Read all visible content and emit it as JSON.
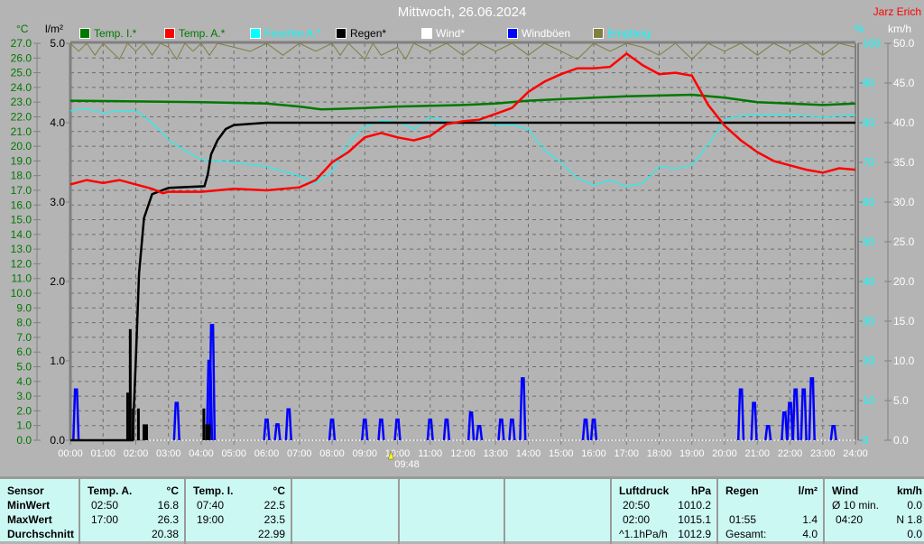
{
  "header": {
    "title": "Mittwoch, 26.06.2024",
    "author": "Jarz Erich"
  },
  "units": {
    "temp": "°C",
    "rain": "l/m²",
    "humidity": "%",
    "wind": "km/h"
  },
  "legend": [
    {
      "label": "Temp. I.*",
      "color": "#007800",
      "text_color": "#007800"
    },
    {
      "label": "Temp. A.*",
      "color": "#ff0000",
      "text_color": "#007800"
    },
    {
      "label": "Feuchte A.*",
      "color": "#00ffff",
      "text_color": "#00ffff"
    },
    {
      "label": "Regen*",
      "color": "#000000",
      "text_color": "#000000"
    },
    {
      "label": "Wind*",
      "color": "#ffffff",
      "text_color": "#ffffff"
    },
    {
      "label": "Windböen",
      "color": "#0000ff",
      "text_color": "#ffffff"
    },
    {
      "label": "Empfang",
      "color": "#7f7f40",
      "text_color": "#00ffff"
    }
  ],
  "marker": {
    "time": "09:48",
    "hour": 9.8
  },
  "chart_data": {
    "type": "line",
    "title": "Mittwoch, 26.06.2024",
    "xlabel": "",
    "xlim": [
      0,
      24
    ],
    "x_ticks": [
      "00:00",
      "01:00",
      "02:00",
      "03:00",
      "04:00",
      "05:00",
      "06:00",
      "07:00",
      "08:00",
      "09:00",
      "10:00",
      "11:00",
      "12:00",
      "13:00",
      "14:00",
      "15:00",
      "16:00",
      "17:00",
      "18:00",
      "19:00",
      "20:00",
      "21:00",
      "22:00",
      "23:00",
      "24:00"
    ],
    "axes": {
      "temp": {
        "label": "°C",
        "range": [
          0,
          27
        ],
        "ticks": [
          "0.0",
          "1.0",
          "2.0",
          "3.0",
          "4.0",
          "5.0",
          "6.0",
          "7.0",
          "8.0",
          "9.0",
          "10.0",
          "11.0",
          "12.0",
          "13.0",
          "14.0",
          "15.0",
          "16.0",
          "17.0",
          "18.0",
          "19.0",
          "20.0",
          "21.0",
          "22.0",
          "23.0",
          "24.0",
          "25.0",
          "26.0",
          "27.0"
        ]
      },
      "rain": {
        "label": "l/m²",
        "range": [
          0,
          5
        ],
        "ticks": [
          "0.0",
          "1.0",
          "2.0",
          "3.0",
          "4.0",
          "5.0"
        ]
      },
      "humidity": {
        "label": "%",
        "range": [
          0,
          100
        ],
        "ticks": [
          "0",
          "10",
          "20",
          "30",
          "40",
          "50",
          "60",
          "70",
          "80",
          "90",
          "100"
        ]
      },
      "wind": {
        "label": "km/h",
        "range": [
          0,
          50
        ],
        "ticks": [
          "0.0",
          "5.0",
          "10.0",
          "15.0",
          "20.0",
          "25.0",
          "30.0",
          "35.0",
          "40.0",
          "45.0",
          "50.0"
        ]
      }
    },
    "grid": true,
    "series": [
      {
        "name": "Temp. I.*",
        "axis": "temp",
        "color": "#007800",
        "points": [
          [
            0,
            23.1
          ],
          [
            4,
            23.0
          ],
          [
            6,
            22.9
          ],
          [
            7,
            22.7
          ],
          [
            7.67,
            22.5
          ],
          [
            9,
            22.6
          ],
          [
            10,
            22.7
          ],
          [
            12,
            22.8
          ],
          [
            13,
            22.9
          ],
          [
            14,
            23.1
          ],
          [
            15,
            23.2
          ],
          [
            16,
            23.3
          ],
          [
            17,
            23.4
          ],
          [
            19,
            23.5
          ],
          [
            20,
            23.3
          ],
          [
            21,
            23.0
          ],
          [
            22,
            22.9
          ],
          [
            23,
            22.8
          ],
          [
            24,
            22.9
          ]
        ]
      },
      {
        "name": "Temp. A.*",
        "axis": "temp",
        "color": "#ff0000",
        "points": [
          [
            0,
            17.4
          ],
          [
            0.5,
            17.7
          ],
          [
            1,
            17.5
          ],
          [
            1.5,
            17.7
          ],
          [
            2,
            17.4
          ],
          [
            2.5,
            17.1
          ],
          [
            2.83,
            16.8
          ],
          [
            3,
            16.9
          ],
          [
            4,
            16.9
          ],
          [
            5,
            17.1
          ],
          [
            6,
            17.0
          ],
          [
            7,
            17.2
          ],
          [
            7.5,
            17.7
          ],
          [
            8,
            18.9
          ],
          [
            8.5,
            19.6
          ],
          [
            9,
            20.6
          ],
          [
            9.5,
            20.9
          ],
          [
            10,
            20.6
          ],
          [
            10.5,
            20.4
          ],
          [
            11,
            20.7
          ],
          [
            11.5,
            21.5
          ],
          [
            12,
            21.7
          ],
          [
            12.5,
            21.8
          ],
          [
            13,
            22.2
          ],
          [
            13.5,
            22.6
          ],
          [
            14,
            23.7
          ],
          [
            14.5,
            24.4
          ],
          [
            15,
            24.9
          ],
          [
            15.5,
            25.3
          ],
          [
            16,
            25.3
          ],
          [
            16.5,
            25.4
          ],
          [
            17,
            26.3
          ],
          [
            17.5,
            25.5
          ],
          [
            18,
            24.9
          ],
          [
            18.5,
            25.0
          ],
          [
            19,
            24.8
          ],
          [
            19.5,
            22.8
          ],
          [
            20,
            21.4
          ],
          [
            20.5,
            20.4
          ],
          [
            21,
            19.6
          ],
          [
            21.5,
            19.0
          ],
          [
            22,
            18.7
          ],
          [
            22.5,
            18.4
          ],
          [
            23,
            18.2
          ],
          [
            23.5,
            18.5
          ],
          [
            24,
            18.4
          ]
        ]
      },
      {
        "name": "Feuchte A.*",
        "axis": "humidity",
        "color": "#00ffff",
        "points": [
          [
            0,
            83
          ],
          [
            0.5,
            83.5
          ],
          [
            1,
            82.5
          ],
          [
            1.5,
            83
          ],
          [
            2,
            83
          ],
          [
            2.5,
            80
          ],
          [
            3,
            75.7
          ],
          [
            3.5,
            73
          ],
          [
            4,
            70.7
          ],
          [
            5,
            70
          ],
          [
            6,
            68.9
          ],
          [
            7,
            66.6
          ],
          [
            7.5,
            64.8
          ],
          [
            8,
            67.7
          ],
          [
            8.5,
            75
          ],
          [
            9,
            79
          ],
          [
            9.5,
            80.5
          ],
          [
            10,
            80.2
          ],
          [
            10.5,
            78.4
          ],
          [
            11,
            81.4
          ],
          [
            11.5,
            80.2
          ],
          [
            12,
            79.8
          ],
          [
            12.5,
            80.7
          ],
          [
            13,
            79.5
          ],
          [
            13.5,
            79.5
          ],
          [
            14,
            78.4
          ],
          [
            14.5,
            73
          ],
          [
            15,
            70
          ],
          [
            15.5,
            66
          ],
          [
            16,
            64.3
          ],
          [
            16.5,
            65.5
          ],
          [
            17,
            63.9
          ],
          [
            17.5,
            64.8
          ],
          [
            18,
            68.9
          ],
          [
            18.5,
            68.4
          ],
          [
            19,
            69.3
          ],
          [
            19.5,
            74.5
          ],
          [
            20,
            80.7
          ],
          [
            20.5,
            81.8
          ],
          [
            21,
            82
          ],
          [
            22,
            82
          ],
          [
            23,
            81.4
          ],
          [
            24,
            82
          ]
        ]
      },
      {
        "name": "Regen*",
        "axis": "rain",
        "color": "#000000",
        "points": [
          [
            0,
            0
          ],
          [
            1.9,
            0
          ],
          [
            2.0,
            1.0
          ],
          [
            2.1,
            2.1
          ],
          [
            2.25,
            2.8
          ],
          [
            2.5,
            3.1
          ],
          [
            3,
            3.18
          ],
          [
            4.1,
            3.2
          ],
          [
            4.2,
            3.35
          ],
          [
            4.3,
            3.6
          ],
          [
            4.5,
            3.78
          ],
          [
            4.75,
            3.92
          ],
          [
            5,
            3.97
          ],
          [
            6,
            4.0
          ],
          [
            24,
            4.0
          ]
        ]
      },
      {
        "name": "Regen bars",
        "axis": "rain",
        "color": "#000000",
        "bars": [
          [
            1.75,
            0.6
          ],
          [
            1.83,
            1.4
          ],
          [
            1.92,
            0.4
          ],
          [
            2.08,
            0.4
          ],
          [
            2.25,
            0.2
          ],
          [
            2.33,
            0.2
          ],
          [
            4.08,
            0.4
          ],
          [
            4.17,
            0.2
          ],
          [
            4.25,
            0.2
          ]
        ]
      },
      {
        "name": "Wind*",
        "axis": "wind",
        "color": "#ffffff",
        "points": [
          [
            2.3,
            0
          ],
          [
            24,
            0
          ]
        ]
      },
      {
        "name": "Windböen",
        "axis": "wind",
        "color": "#0000ff",
        "spikes": [
          [
            0.17,
            6.4
          ],
          [
            3.25,
            4.7
          ],
          [
            4.25,
            10
          ],
          [
            4.33,
            14.5
          ],
          [
            6.0,
            2.6
          ],
          [
            6.33,
            2.0
          ],
          [
            6.67,
            3.9
          ],
          [
            8.0,
            2.6
          ],
          [
            9.0,
            2.6
          ],
          [
            9.5,
            2.6
          ],
          [
            10.0,
            2.6
          ],
          [
            11.0,
            2.6
          ],
          [
            11.5,
            2.6
          ],
          [
            12.25,
            3.5
          ],
          [
            12.5,
            1.8
          ],
          [
            13.17,
            2.6
          ],
          [
            13.5,
            2.6
          ],
          [
            13.83,
            7.8
          ],
          [
            15.75,
            2.6
          ],
          [
            16.0,
            2.6
          ],
          [
            20.5,
            6.4
          ],
          [
            20.9,
            4.7
          ],
          [
            21.33,
            1.8
          ],
          [
            21.83,
            3.5
          ],
          [
            22.0,
            4.7
          ],
          [
            22.17,
            6.4
          ],
          [
            22.42,
            6.4
          ],
          [
            22.67,
            7.8
          ],
          [
            23.33,
            1.8
          ]
        ]
      },
      {
        "name": "Empfang",
        "axis": "humidity",
        "color": "#7f7f40",
        "points": [
          [
            0,
            100
          ],
          [
            0.25,
            98
          ],
          [
            0.5,
            100
          ],
          [
            0.75,
            97
          ],
          [
            1,
            100
          ],
          [
            1.25,
            98
          ],
          [
            1.5,
            96
          ],
          [
            1.75,
            100
          ],
          [
            2,
            98
          ],
          [
            2.25,
            100
          ],
          [
            2.5,
            97
          ],
          [
            2.75,
            100
          ],
          [
            3,
            99
          ],
          [
            3.25,
            96
          ],
          [
            3.5,
            100
          ],
          [
            3.75,
            98
          ],
          [
            4,
            100
          ],
          [
            4.25,
            97
          ],
          [
            4.5,
            100
          ],
          [
            5,
            99
          ],
          [
            5.5,
            98
          ],
          [
            6,
            100
          ],
          [
            6.5,
            97
          ],
          [
            7,
            100
          ],
          [
            7.5,
            98
          ],
          [
            8,
            100
          ],
          [
            8.25,
            97
          ],
          [
            8.5,
            100
          ],
          [
            9,
            96
          ],
          [
            9.25,
            100
          ],
          [
            9.5,
            97
          ],
          [
            10,
            99
          ],
          [
            10.25,
            96
          ],
          [
            10.5,
            100
          ],
          [
            11,
            98
          ],
          [
            11.5,
            100
          ],
          [
            12,
            97
          ],
          [
            12.5,
            100
          ],
          [
            13,
            98
          ],
          [
            13.5,
            100
          ],
          [
            14,
            97
          ],
          [
            14.5,
            100
          ],
          [
            15,
            98
          ],
          [
            15.5,
            96
          ],
          [
            16,
            100
          ],
          [
            16.5,
            98
          ],
          [
            17,
            100
          ],
          [
            17.5,
            99
          ],
          [
            18,
            97
          ],
          [
            18.5,
            100
          ],
          [
            19,
            96
          ],
          [
            19.5,
            100
          ],
          [
            20,
            98
          ],
          [
            20.5,
            100
          ],
          [
            21,
            97
          ],
          [
            21.5,
            100
          ],
          [
            22,
            98
          ],
          [
            22.5,
            100
          ],
          [
            23,
            97
          ],
          [
            23.5,
            100
          ],
          [
            24,
            99
          ]
        ]
      }
    ]
  },
  "table": {
    "sensor": {
      "header": "Sensor",
      "rows": [
        "MinWert",
        "MaxWert",
        "Durchschnitt"
      ]
    },
    "temp_a": {
      "header": "Temp. A.",
      "unit": "°C",
      "min_time": "02:50",
      "min": "16.8",
      "max_time": "17:00",
      "max": "26.3",
      "avg": "20.38"
    },
    "temp_i": {
      "header": "Temp. I.",
      "unit": "°C",
      "min_time": "07:40",
      "min": "22.5",
      "max_time": "19:00",
      "max": "23.5",
      "avg": "22.99"
    },
    "pressure": {
      "header": "Luftdruck",
      "unit": "hPa",
      "min_time": "20:50",
      "min": "1010.2",
      "max_time": "02:00",
      "max": "1015.1",
      "trend": "^1.1hPa/h",
      "avg": "1012.9"
    },
    "rain": {
      "header": "Regen",
      "unit": "l/m²",
      "max_time": "01:55",
      "max": "1.4",
      "total_label": "Gesamt:",
      "total": "4.0"
    },
    "wind": {
      "header": "Wind",
      "unit": "km/h",
      "avg_label": "Ø 10 min.",
      "avg": "0.0",
      "max_time": "04:20",
      "max": "N 1.8",
      "mean": "0.0"
    }
  }
}
